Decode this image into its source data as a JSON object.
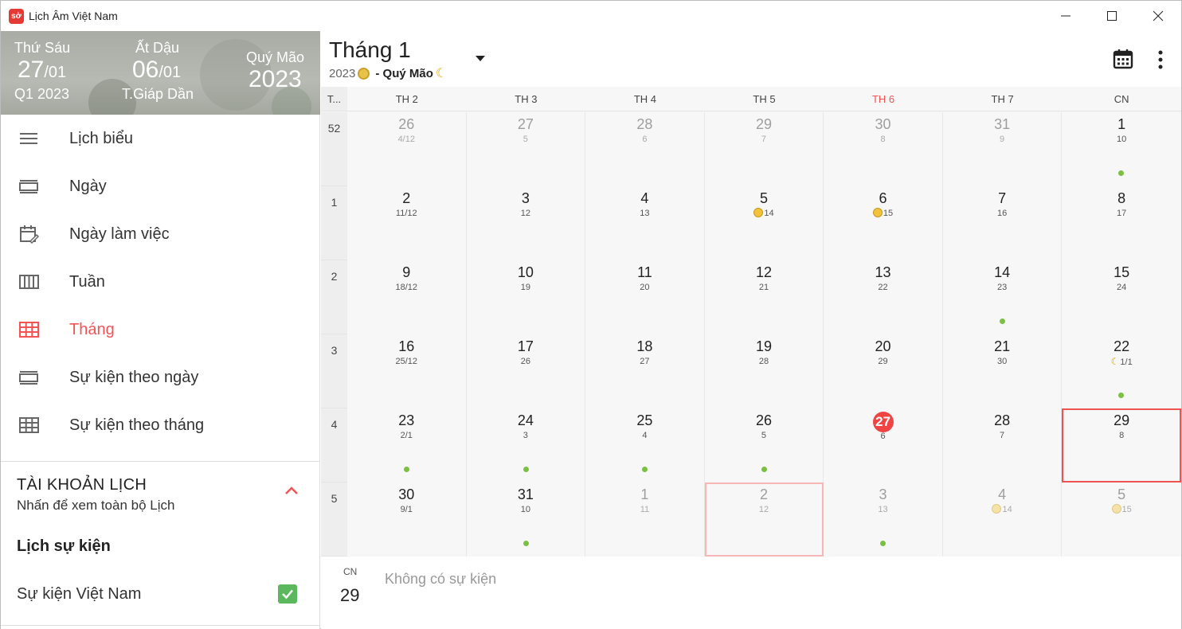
{
  "window": {
    "title": "Lịch Âm Việt Nam",
    "icon_text": "sở"
  },
  "banner": {
    "col1": {
      "label": "Thứ Sáu",
      "big": "27",
      "small": "/01",
      "sub": "Q1 2023"
    },
    "col2": {
      "label": "Ất Dậu",
      "big": "06",
      "small": "/01",
      "sub": "T.Giáp Dần"
    },
    "col3": {
      "label": "Quý Mão",
      "big": "2023"
    }
  },
  "nav": [
    {
      "label": "Lịch biểu",
      "icon": "agenda-icon",
      "active": false
    },
    {
      "label": "Ngày",
      "icon": "day-view-icon",
      "active": false
    },
    {
      "label": "Ngày làm việc",
      "icon": "workday-icon",
      "active": false
    },
    {
      "label": "Tuần",
      "icon": "week-view-icon",
      "active": false
    },
    {
      "label": "Tháng",
      "icon": "month-view-icon",
      "active": true
    },
    {
      "label": "Sự kiện theo ngày",
      "icon": "events-by-day-icon",
      "active": false
    },
    {
      "label": "Sự kiện theo tháng",
      "icon": "events-by-month-icon",
      "active": false
    }
  ],
  "account": {
    "title": "TÀI KHOẢN LỊCH",
    "subtitle": "Nhấn để xem toàn bộ Lịch"
  },
  "calendars": {
    "title": "Lịch sự kiện",
    "item": "Sự kiện Việt Nam",
    "checked": true
  },
  "header": {
    "month": "Tháng 1",
    "year": "2023",
    "year_name": "- Quý Mão"
  },
  "weekday_header": {
    "week_col": "T...",
    "days": [
      "TH 2",
      "TH 3",
      "TH 4",
      "TH 5",
      "TH 6",
      "TH 7",
      "CN"
    ],
    "red_index": 4
  },
  "weeks": [
    {
      "num": "52",
      "days": [
        {
          "s": "26",
          "l": "4/12",
          "dim": true
        },
        {
          "s": "27",
          "l": "5",
          "dim": true
        },
        {
          "s": "28",
          "l": "6",
          "dim": true
        },
        {
          "s": "29",
          "l": "7",
          "dim": true
        },
        {
          "s": "30",
          "l": "8",
          "dim": true
        },
        {
          "s": "31",
          "l": "9",
          "dim": true
        },
        {
          "s": "1",
          "l": "10",
          "dot": true
        }
      ]
    },
    {
      "num": "1",
      "days": [
        {
          "s": "2",
          "l": "11/12"
        },
        {
          "s": "3",
          "l": "12"
        },
        {
          "s": "4",
          "l": "13"
        },
        {
          "s": "5",
          "l": "14",
          "sun": true
        },
        {
          "s": "6",
          "l": "15",
          "sun": true
        },
        {
          "s": "7",
          "l": "16"
        },
        {
          "s": "8",
          "l": "17"
        }
      ]
    },
    {
      "num": "2",
      "days": [
        {
          "s": "9",
          "l": "18/12"
        },
        {
          "s": "10",
          "l": "19"
        },
        {
          "s": "11",
          "l": "20"
        },
        {
          "s": "12",
          "l": "21"
        },
        {
          "s": "13",
          "l": "22"
        },
        {
          "s": "14",
          "l": "23",
          "dot": true
        },
        {
          "s": "15",
          "l": "24"
        }
      ]
    },
    {
      "num": "3",
      "days": [
        {
          "s": "16",
          "l": "25/12"
        },
        {
          "s": "17",
          "l": "26"
        },
        {
          "s": "18",
          "l": "27"
        },
        {
          "s": "19",
          "l": "28"
        },
        {
          "s": "20",
          "l": "29"
        },
        {
          "s": "21",
          "l": "30"
        },
        {
          "s": "22",
          "l": "1/1",
          "moon": true,
          "dot": true
        }
      ]
    },
    {
      "num": "4",
      "days": [
        {
          "s": "23",
          "l": "2/1",
          "dot": true
        },
        {
          "s": "24",
          "l": "3",
          "dot": true
        },
        {
          "s": "25",
          "l": "4",
          "dot": true
        },
        {
          "s": "26",
          "l": "5",
          "dot": true
        },
        {
          "s": "27",
          "l": "6",
          "today": true
        },
        {
          "s": "28",
          "l": "7"
        },
        {
          "s": "29",
          "l": "8",
          "selected": true
        }
      ]
    },
    {
      "num": "5",
      "days": [
        {
          "s": "30",
          "l": "9/1"
        },
        {
          "s": "31",
          "l": "10",
          "dot": true
        },
        {
          "s": "1",
          "l": "11",
          "dim": true
        },
        {
          "s": "2",
          "l": "12",
          "dim": true,
          "highlight": true
        },
        {
          "s": "3",
          "l": "13",
          "dim": true,
          "dot": true
        },
        {
          "s": "4",
          "l": "14",
          "dim": true,
          "sun": true
        },
        {
          "s": "5",
          "l": "15",
          "dim": true,
          "sun": true
        }
      ]
    }
  ],
  "event_panel": {
    "dow": "CN",
    "day": "29",
    "empty_text": "Không có sự kiện"
  },
  "colors": {
    "accent": "#f25353",
    "event_dot": "#7bc043",
    "check": "#5cb85c"
  }
}
